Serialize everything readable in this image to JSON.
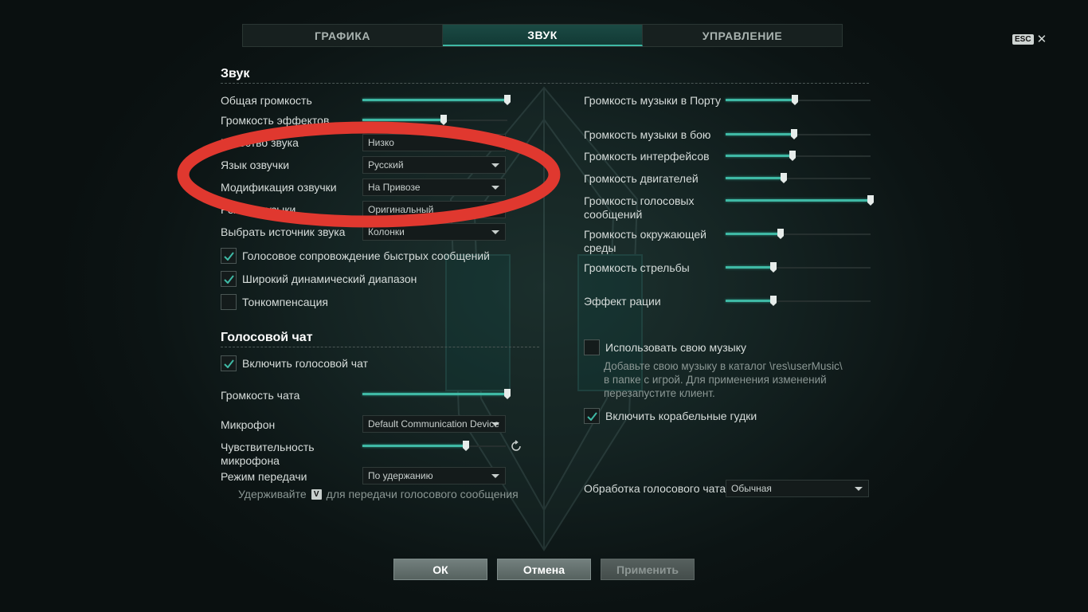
{
  "tabs": [
    {
      "label": "ГРАФИКА",
      "active": false
    },
    {
      "label": "ЗВУК",
      "active": true
    },
    {
      "label": "УПРАВЛЕНИЕ",
      "active": false
    }
  ],
  "esc": {
    "key": "ESC",
    "close": "✕"
  },
  "sound_section": {
    "title": "Звук",
    "general_volume": {
      "label": "Общая громкость",
      "value": 1.0
    },
    "effects_volume": {
      "label": "Громкость эффектов",
      "value": 0.56
    },
    "sound_quality": {
      "label": "Качество звука",
      "value": "Низко"
    },
    "voice_language": {
      "label": "Язык озвучки",
      "value": "Русский"
    },
    "voice_mod": {
      "label": "Модификация озвучки",
      "value": "На Привозе"
    },
    "music_mode": {
      "label": "Режим музыки",
      "value": "Оригинальный"
    },
    "sound_source": {
      "label": "Выбрать источник звука",
      "value": "Колонки"
    },
    "cb_quick_messages": {
      "label": "Голосовое сопровождение быстрых сообщений",
      "checked": true
    },
    "cb_dynamic_range": {
      "label": "Широкий динамический диапазон",
      "checked": true
    },
    "cb_tone_comp": {
      "label": "Тонкомпенсация",
      "checked": false
    }
  },
  "right_volumes": {
    "music_port": {
      "label": "Громкость музыки в Порту",
      "value": 0.48
    },
    "music_battle": {
      "label": "Громкость музыки в бою",
      "value": 0.47
    },
    "interface": {
      "label": "Громкость интерфейсов",
      "value": 0.46
    },
    "engines": {
      "label": "Громкость двигателей",
      "value": 0.4
    },
    "voice_messages": {
      "label": "Громкость голосовых сообщений",
      "value": 1.0
    },
    "environment": {
      "label": "Громкость окружающей среды",
      "value": 0.38
    },
    "shooting": {
      "label": "Громкость стрельбы",
      "value": 0.33
    },
    "radio_effect": {
      "label": "Эффект рации",
      "value": 0.33
    }
  },
  "custom_music": {
    "label": "Использовать свою музыку",
    "checked": false,
    "note": "Добавьте свою музыку в каталог \\res\\userMusic\\ в папке с игрой. Для применения изменений перезапустите клиент."
  },
  "ship_horns": {
    "label": "Включить корабельные гудки",
    "checked": true
  },
  "voice_chat": {
    "title": "Голосовой чат",
    "enable": {
      "label": "Включить голосовой чат",
      "checked": true
    },
    "chat_volume": {
      "label": "Громкость чата",
      "value": 1.0
    },
    "microphone": {
      "label": "Микрофон",
      "value": "Default Communication Device"
    },
    "mic_sensitivity": {
      "label": "Чувствительность микрофона",
      "value": 0.72
    },
    "transmit_mode": {
      "label": "Режим передачи",
      "value": "По удержанию"
    },
    "hint_pre": "Удерживайте",
    "hint_key": "V",
    "hint_post": "для передачи голосового сообщения",
    "processing": {
      "label": "Обработка голосового чата",
      "value": "Обычная"
    }
  },
  "buttons": {
    "ok": "ОК",
    "cancel": "Отмена",
    "apply": "Применить"
  },
  "colors": {
    "accent": "#3fb9a5",
    "annotation": "#e0382f"
  }
}
